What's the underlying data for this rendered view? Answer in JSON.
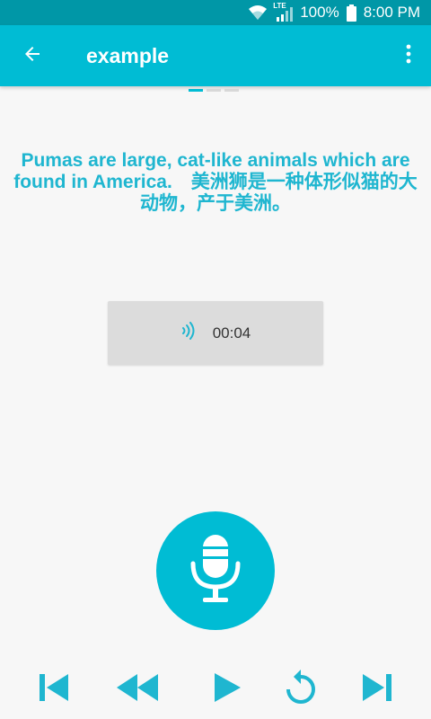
{
  "status_bar": {
    "battery": "100%",
    "time": "8:00 PM",
    "network_label": "LTE",
    "icons": [
      "wifi-icon",
      "lte-signal-icon",
      "battery-icon"
    ]
  },
  "app_bar": {
    "title": "example",
    "icons": [
      "arrow-back-icon",
      "more-vert-icon"
    ]
  },
  "pager": {
    "pages": 3,
    "current": 1
  },
  "sentence": {
    "text": "Pumas are large, cat-like animals which are found in America.　美洲狮是一种体形似猫的大动物，产于美洲。"
  },
  "audio_clip": {
    "duration": "00:04",
    "icon": "speaker-wave-icon"
  },
  "record_button": {
    "icon": "microphone-icon"
  },
  "controls": {
    "icons": [
      "skip-previous-icon",
      "rewind-icon",
      "play-icon",
      "replay-icon",
      "skip-next-icon"
    ]
  },
  "colors": {
    "accent": "#00bcd4",
    "status_bar": "#0097a7",
    "sentence_text": "#1fb6d0",
    "background": "#f7f7f7"
  }
}
